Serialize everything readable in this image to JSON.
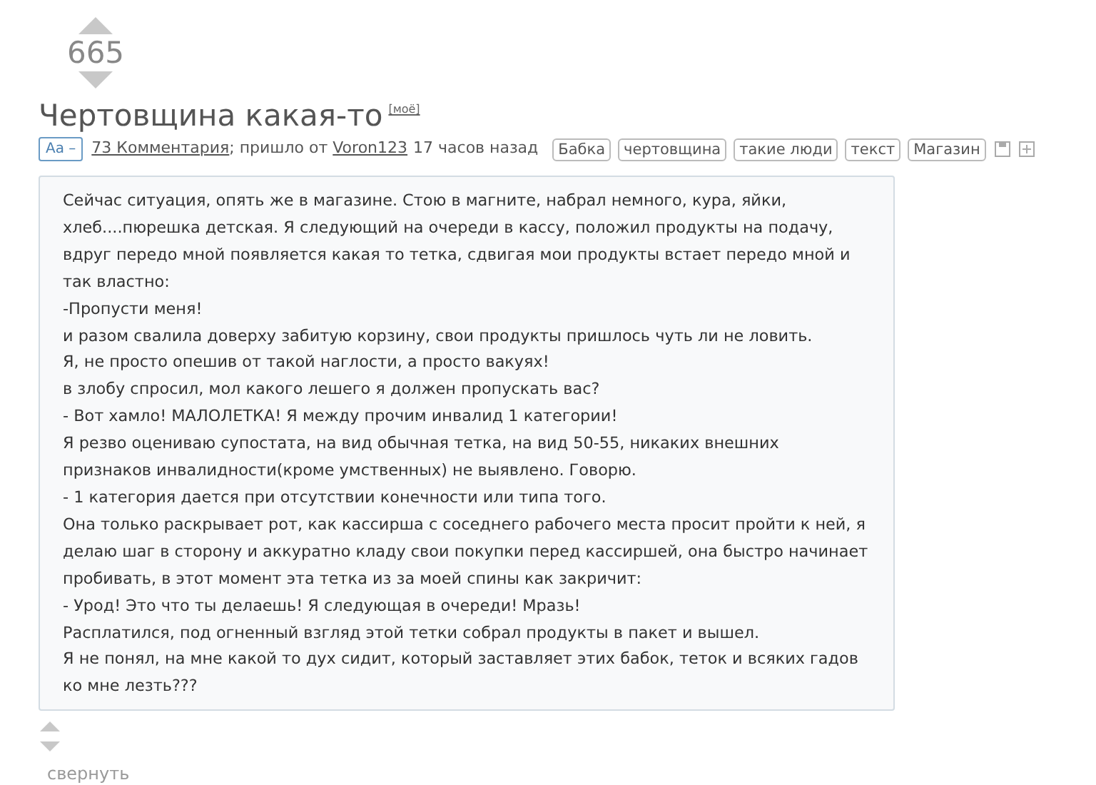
{
  "rating": "665",
  "title": "Чертовщина какая-то",
  "title_badge": "[моё]",
  "meta": {
    "font_toggle": "Aa –",
    "comments_link": "73 Комментария",
    "posted_from": "; пришло от",
    "author": "Voron123",
    "time": "17 часов назад"
  },
  "tags": [
    "Бабка",
    "чертовщина",
    "такие люди",
    "текст",
    "Магазин"
  ],
  "body": [
    "Сейчас ситуация, опять же в магазине. Стою в магните, набрал немного, кура, яйки, хлеб....пюрешка детская. Я следующий на очереди в кассу, положил продукты на подачу, вдруг передо мной появляется какая то тетка, сдвигая мои продукты встает передо мной и так властно:",
    "-Пропусти меня!",
    "и разом свалила доверху забитую корзину, свои продукты пришлось чуть ли не ловить.",
    "Я, не просто опешив от такой наглости, а просто вакуях!",
    "в злобу спросил, мол какого лешего я должен пропускать вас?",
    "- Вот хамло! МАЛОЛЕТКА! Я между прочим инвалид 1 категории!",
    "Я резво оцениваю супостата, на вид обычная тетка, на вид 50-55, никаких внешних признаков инвалидности(кроме умственных) не выявлено. Говорю.",
    "- 1 категория дается при отсутствии конечности или типа того.",
    "Она только раскрывает рот, как кассирша с соседнего рабочего места просит пройти к ней, я делаю шаг в сторону и аккуратно кладу свои покупки перед кассиршей, она быстро начинает пробивать, в этот момент эта тетка из за моей спины как закричит:",
    "- Урод! Это что ты делаешь! Я следующая в очереди! Мразь!",
    "Расплатился, под огненный взгляд этой тетки собрал продукты в пакет и вышел.",
    "Я не понял, на мне какой то дух сидит, который заставляет этих бабок, теток и всяких гадов ко мне лезть???"
  ],
  "collapse_link": "свернуть"
}
